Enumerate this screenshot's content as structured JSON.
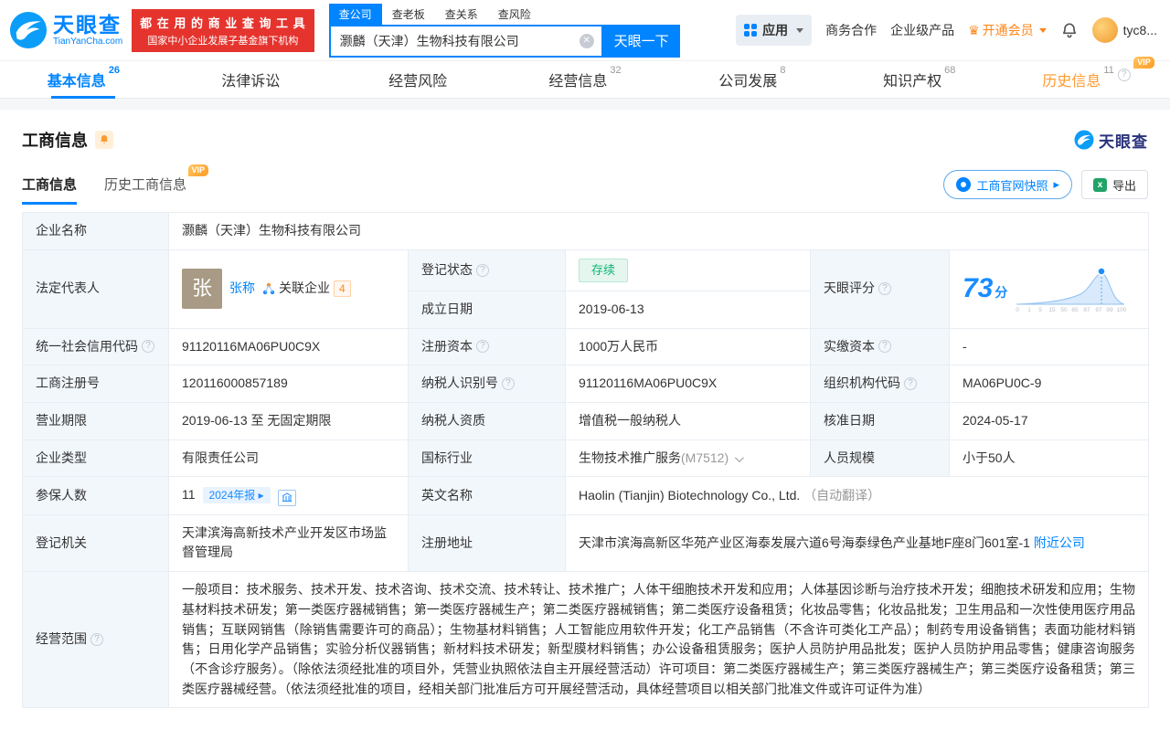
{
  "colors": {
    "brand_blue": "#0084ff",
    "brand_red": "#e5342e",
    "vip_gold": "#ff9c26",
    "member_orange": "#ff8519",
    "status_green": "#0fb579",
    "score_blue": "#1a8cff",
    "label_bg": "#f2f7fc",
    "table_border": "#e8edf3"
  },
  "icons": {
    "help": "?",
    "clear": "✕",
    "crown": "♛",
    "arrow": "▸",
    "excel": "x"
  },
  "vip_text": "VIP",
  "header": {
    "logo_cn": "天眼查",
    "logo_en": "TianYanCha.com",
    "slogan_line1": "都 在 用 的 商 业 查 询 工 具",
    "slogan_line2": "国家中小企业发展子基金旗下机构",
    "search": {
      "tabs": [
        {
          "label": "查公司"
        },
        {
          "label": "查老板"
        },
        {
          "label": "查关系"
        },
        {
          "label": "查风险"
        }
      ],
      "value": "灏麟（天津）生物科技有限公司",
      "button": "天眼一下"
    },
    "nav_app": "应用",
    "nav_biz": "商务合作",
    "nav_enterprise": "企业级产品",
    "nav_member": "开通会员",
    "nav_user": "tyc8..."
  },
  "nav_tabs": [
    {
      "label": "基本信息",
      "count": "26"
    },
    {
      "label": "法律诉讼",
      "count": ""
    },
    {
      "label": "经营风险",
      "count": ""
    },
    {
      "label": "经营信息",
      "count": "32"
    },
    {
      "label": "公司发展",
      "count": "8"
    },
    {
      "label": "知识产权",
      "count": "68"
    },
    {
      "label": "历史信息",
      "count": "11"
    }
  ],
  "section": {
    "title": "工商信息",
    "subtab_main": "工商信息",
    "subtab_history": "历史工商信息",
    "btn_snapshot": "工商官网快照",
    "btn_export": "导出",
    "logo_text": "天眼查"
  },
  "info": {
    "company_name_label": "企业名称",
    "company_name": "灏麟（天津）生物科技有限公司",
    "legal_rep_label": "法定代表人",
    "avatar_char": "张",
    "legal_rep_name": "张称",
    "related_label": "关联企业",
    "related_count": "4",
    "reg_status_label": "登记状态",
    "reg_status": "存续",
    "establish_date_label": "成立日期",
    "establish_date": "2019-06-13",
    "score_label": "天眼评分",
    "score_value": "73",
    "score_unit": "分",
    "score_ticks": [
      "0",
      "1",
      "5",
      "15",
      "50",
      "65",
      "87",
      "97",
      "99",
      "100"
    ],
    "credit_code_label": "统一社会信用代码",
    "credit_code": "91120116MA06PU0C9X",
    "reg_capital_label": "注册资本",
    "reg_capital": "1000万人民币",
    "paid_capital_label": "实缴资本",
    "paid_capital": "-",
    "reg_number_label": "工商注册号",
    "reg_number": "120116000857189",
    "taxpayer_id_label": "纳税人识别号",
    "taxpayer_id": "91120116MA06PU0C9X",
    "org_code_label": "组织机构代码",
    "org_code": "MA06PU0C-9",
    "business_term_label": "营业期限",
    "business_term": "2019-06-13 至 无固定期限",
    "taxpayer_quality_label": "纳税人资质",
    "taxpayer_quality": "增值税一般纳税人",
    "approval_date_label": "核准日期",
    "approval_date": "2024-05-17",
    "company_type_label": "企业类型",
    "company_type": "有限责任公司",
    "industry_label": "国标行业",
    "industry": "生物技术推广服务",
    "industry_code": "(M7512)",
    "staff_size_label": "人员规模",
    "staff_size": "小于50人",
    "insured_label": "参保人数",
    "insured_count": "11",
    "insured_badge": "2024年报 ▸",
    "english_name_label": "英文名称",
    "english_name": "Haolin (Tianjin) Biotechnology Co., Ltd.",
    "english_name_note": "（自动翻译）",
    "reg_authority_label": "登记机关",
    "reg_authority": "天津滨海高新技术产业开发区市场监督管理局",
    "address_label": "注册地址",
    "address": "天津市滨海高新区华苑产业区海泰发展六道6号海泰绿色产业基地F座8门601室-1",
    "nearby_link": "附近公司",
    "scope_label": "经营范围",
    "scope": "一般项目：技术服务、技术开发、技术咨询、技术交流、技术转让、技术推广；人体干细胞技术开发和应用；人体基因诊断与治疗技术开发；细胞技术研发和应用；生物基材料技术研发；第一类医疗器械销售；第一类医疗器械生产；第二类医疗器械销售；第二类医疗设备租赁；化妆品零售；化妆品批发；卫生用品和一次性使用医疗用品销售；互联网销售（除销售需要许可的商品）；生物基材料销售；人工智能应用软件开发；化工产品销售（不含许可类化工产品）；制药专用设备销售；表面功能材料销售；日用化学产品销售；实验分析仪器销售；新材料技术研发；新型膜材料销售；办公设备租赁服务；医护人员防护用品批发；医护人员防护用品零售；健康咨询服务（不含诊疗服务）。（除依法须经批准的项目外，凭营业执照依法自主开展经营活动）许可项目：第二类医疗器械生产；第三类医疗器械生产；第三类医疗设备租赁；第三类医疗器械经营。（依法须经批准的项目，经相关部门批准后方可开展经营活动，具体经营项目以相关部门批准文件或许可证件为准）"
  }
}
